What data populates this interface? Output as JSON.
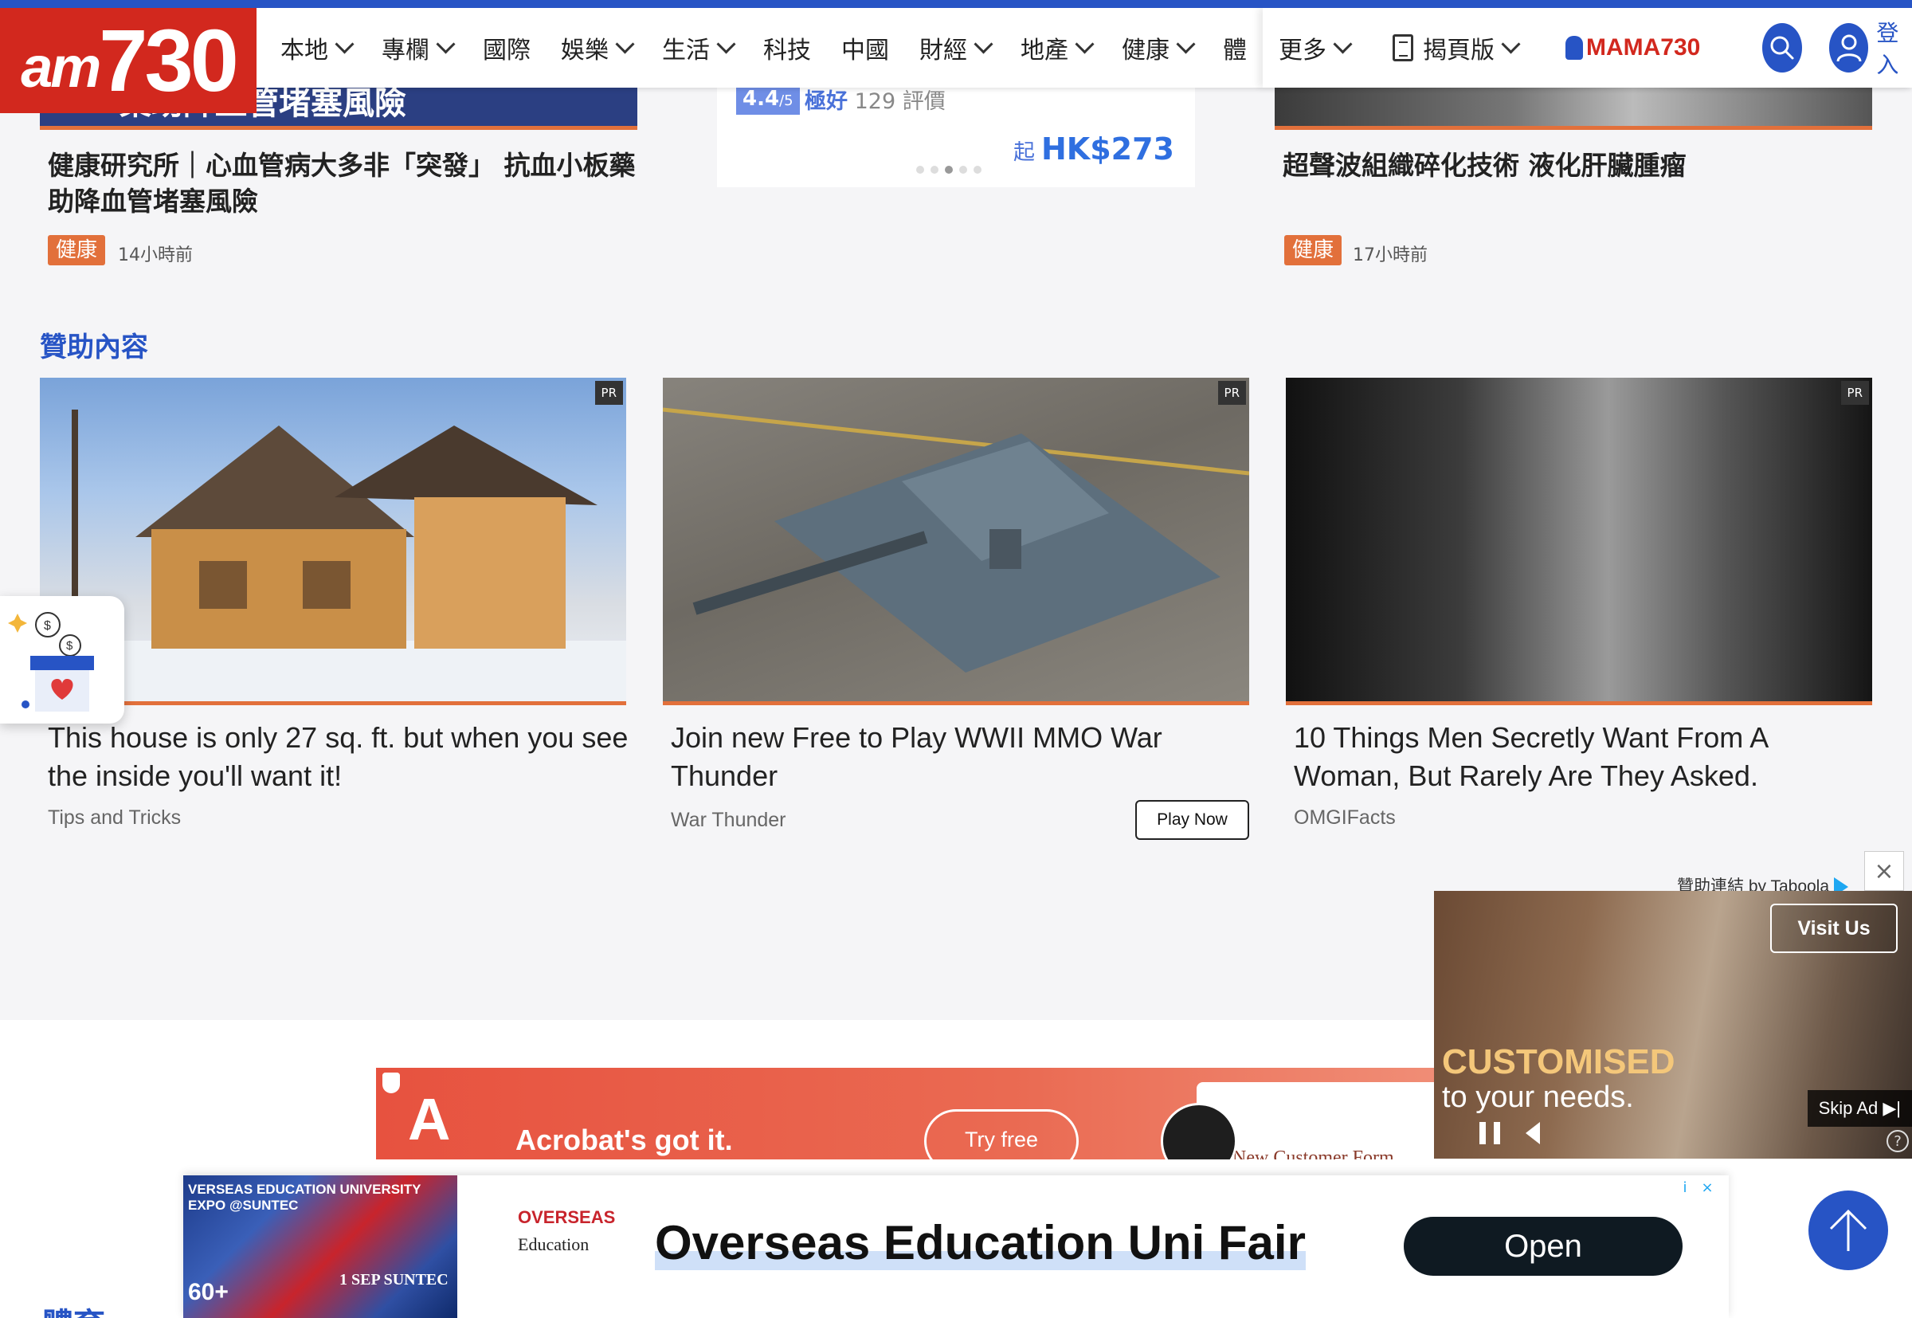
{
  "nav": {
    "logo_prefix": "am",
    "logo_number": "730",
    "items": [
      {
        "label": "本地",
        "dropdown": true
      },
      {
        "label": "專欄",
        "dropdown": true
      },
      {
        "label": "國際",
        "dropdown": false
      },
      {
        "label": "娛樂",
        "dropdown": true
      },
      {
        "label": "生活",
        "dropdown": true
      },
      {
        "label": "科技",
        "dropdown": false
      },
      {
        "label": "中國",
        "dropdown": false
      },
      {
        "label": "財經",
        "dropdown": true
      },
      {
        "label": "地產",
        "dropdown": true
      },
      {
        "label": "健康",
        "dropdown": true
      },
      {
        "label": "體",
        "dropdown": false
      }
    ],
    "more_label": "更多",
    "epaper_label": "揭頁版",
    "mama_label": "MAMA730",
    "login_label": "登入"
  },
  "top_articles": {
    "left": {
      "image_text": "藥助降血管堵塞風險",
      "title": "健康研究所｜心血管病大多非「突發」 抗血小板藥助降血管堵塞風險",
      "tag": "健康",
      "time": "14小時前"
    },
    "middle": {
      "rating": "4.4",
      "rating_max": "/5",
      "rating_word": "極好",
      "reviews": "129 評價",
      "price_prefix": "起",
      "price": "HK$273"
    },
    "right": {
      "title": "超聲波組織碎化技術 液化肝臟腫瘤",
      "tag": "健康",
      "time": "17小時前"
    }
  },
  "sponsored": {
    "section_title": "贊助內容",
    "pr_label": "PR",
    "cards": [
      {
        "title": "This house is only 27 sq. ft. but when you see the inside you'll want it!",
        "source": "Tips and Tricks"
      },
      {
        "title": "Join new Free to Play WWII MMO War Thunder",
        "source": "War Thunder",
        "cta": "Play Now"
      },
      {
        "title": "10 Things Men Secretly Want From A Woman, But Rarely Are They Asked.",
        "source": "OMGIFacts"
      }
    ],
    "attribution": "贊助連結 by Taboola"
  },
  "video_ad": {
    "cta": "Visit Us",
    "headline": "CUSTOMISED",
    "subline": "to your needs.",
    "skip_label": "Skip Ad",
    "help": "?",
    "close": "×"
  },
  "acrobat_ad": {
    "logo": "A",
    "text": "Acrobat's got it.",
    "cta": "Try free",
    "form_label": "New Customer Form"
  },
  "sticky_ad": {
    "image_title": "VERSEAS EDUCATION UNIVERSITY EXPO @SUNTEC",
    "image_count": "60+",
    "image_date": "1 SEP SUNTEC",
    "brand_line1": "OVERSEAS",
    "brand_line2": "Education",
    "headline": "Overseas Education Uni Fair",
    "cta": "Open",
    "info": "i",
    "close": "×"
  },
  "below": {
    "section_title": "體育"
  },
  "colors": {
    "brand_blue": "#2754c5",
    "brand_red": "#d2281e",
    "tag_orange": "#e2703b"
  },
  "icons": [
    "chevron-down-icon",
    "document-icon",
    "search-icon",
    "user-icon",
    "arrow-up-icon",
    "pause-icon",
    "volume-icon",
    "skip-icon",
    "close-icon",
    "gift-icon"
  ]
}
